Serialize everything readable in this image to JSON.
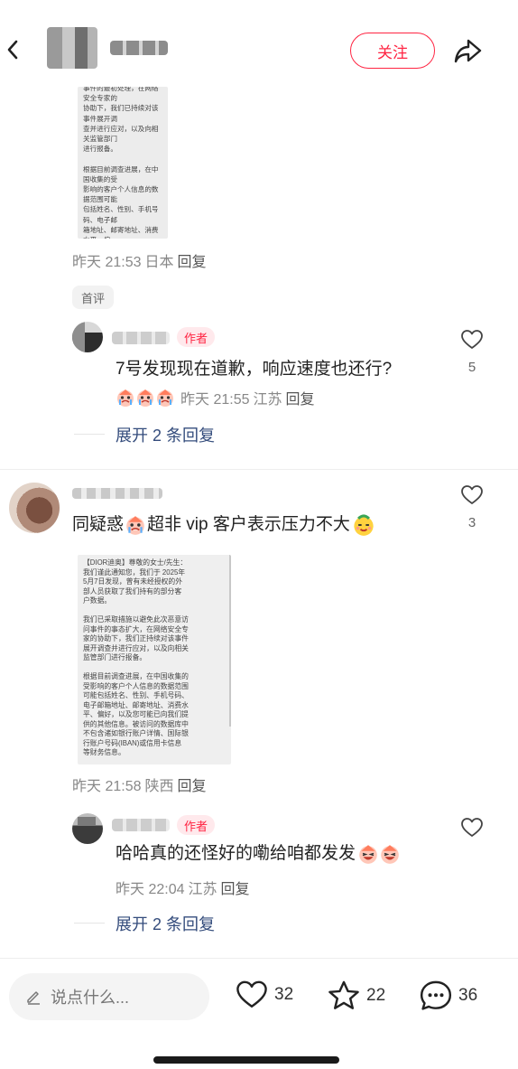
{
  "header": {
    "follow_label": "关注",
    "icons": {
      "back": "chevron-left-icon",
      "share": "share-icon"
    }
  },
  "post": {
    "image1_text": "事件的最初处理，在网络安全专家的\n协助下，我们已持续对该事件展开调\n查并进行应对，以及向相关监管部门\n进行报备。\n\n根据目前调查进展，在中国收集的受\n影响的客户个人信息的数据范围可能\n包括姓名、性别、手机号码、电子邮\n箱地址、邮寄地址、消费水平、偏\n好，以及您可能已向我们提供的其他\n信息。被访问的数据库中不包含诸如\n银行账户详情、国际银行账户号码\n(IBAN)或信用卡信息等财务信息。\n\n初步调查显示，此次事件是由数据库\n遭受未经授权的访问所致。作为最佳\n做法，并且出于高度谨慎的考虑，我\n们建议您对任何可疑通信(短信、电\n话、电子邮件)都要保持警惕，不要",
    "meta_time": "昨天 21:53",
    "meta_location": "日本",
    "meta_reply": "回复",
    "first_tag": "首评"
  },
  "reply1": {
    "author_badge": "作者",
    "text": "7号发现现在道歉，响应速度也还行?",
    "meta_time": "昨天 21:55",
    "meta_location": "江苏",
    "meta_reply": "回复",
    "like_count": "5",
    "expand_label": "展开 2 条回复"
  },
  "comment2": {
    "text_part1": "同疑惑",
    "text_part2": "超非 vip 客户表示压力不大",
    "like_count": "3",
    "image2_text": "【DIOR迪奥】尊敬的女士/先生：\n我们谨此通知您，我们于 2025年\n5月7日发现，曾有未经授权的外\n部人员获取了我们持有的部分客\n户数据。\n\n我们已采取措施以避免此次恶意访\n问事件的事态扩大，在网络安全专\n家的协助下，我们正持续对该事件\n展开调查并进行应对，以及向相关\n监管部门进行报备。\n\n根据目前调查进展，在中国收集的\n受影响的客户个人信息的数据范围\n可能包括姓名、性别、手机号码、\n电子邮箱地址、邮寄地址、消费水\n平、偏好，以及您可能已向我们提\n供的其他信息。被访问的数据库中\n不包含诸如银行账户详情、国际银\n行账户号码(IBAN)或信用卡信息\n等财务信息。\n\n初步调查显示，此次事件是由数据\n库遭受未经授权的访问所致。作为\n最佳做法，并且出于高度谨慎的考",
    "meta_time": "昨天 21:58",
    "meta_location": "陕西",
    "meta_reply": "回复"
  },
  "reply2": {
    "author_badge": "作者",
    "text": "哈哈真的还怪好的嘞给咱都发发",
    "meta_time": "昨天 22:04",
    "meta_location": "江苏",
    "meta_reply": "回复",
    "expand_label": "展开 2 条回复"
  },
  "bottom": {
    "input_placeholder": "说点什么...",
    "likes": "32",
    "favorites": "22",
    "comments": "36"
  },
  "colors": {
    "accent": "#ff2442",
    "link": "#344c7c"
  }
}
